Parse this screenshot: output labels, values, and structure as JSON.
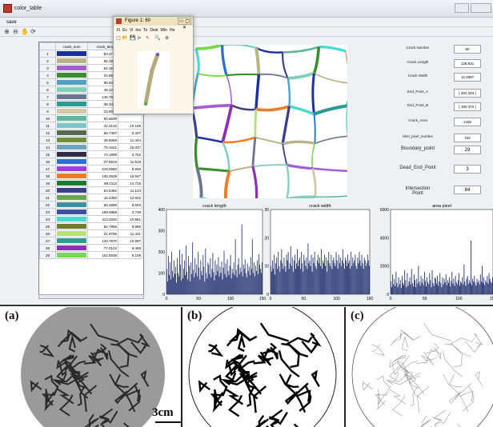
{
  "window": {
    "title": "color_table"
  },
  "menu": {
    "save": "save"
  },
  "toolbar": {
    "icons": [
      "zoom-in-icon",
      "zoom-out-icon",
      "pan-icon",
      "rotate-icon"
    ]
  },
  "table": {
    "headers": [
      "crack_num",
      "crack_length",
      "c"
    ],
    "rows": [
      {
        "n": "1",
        "color": "#1c2fa0",
        "len": "83.4767",
        "ext": ""
      },
      {
        "n": "2",
        "color": "#b9b487",
        "len": "56.1838",
        "ext": ""
      },
      {
        "n": "3",
        "color": "#a25ed3",
        "len": "62.1599",
        "ext": ""
      },
      {
        "n": "4",
        "color": "#3b8e2e",
        "len": "24.8640",
        "ext": ""
      },
      {
        "n": "5",
        "color": "#4fa3c9",
        "len": "85.8467",
        "ext": ""
      },
      {
        "n": "6",
        "color": "#7dd0ba",
        "len": "48.1274",
        "ext": ""
      },
      {
        "n": "7",
        "color": "#6a7590",
        "len": "145.7676",
        "ext": ""
      },
      {
        "n": "8",
        "color": "#2a9a92",
        "len": "38.3482",
        "ext": ""
      },
      {
        "n": "9",
        "color": "#d2c8a6",
        "len": "23.6056",
        "ext": ""
      },
      {
        "n": "10",
        "color": "#5eb79c",
        "len": "84.6639",
        "ext": ""
      },
      {
        "n": "11",
        "color": "#7ec8cc",
        "len": "42.2132",
        "ext": "10.169"
      },
      {
        "n": "12",
        "color": "#4f6c4e",
        "len": "66.7487",
        "ext": "5.427"
      },
      {
        "n": "13",
        "color": "#6f8f3a",
        "len": "28.6569",
        "ext": "11.444"
      },
      {
        "n": "14",
        "color": "#6da6c1",
        "len": "75.1641",
        "ext": "15.037"
      },
      {
        "n": "15",
        "color": "#2d2a4a",
        "len": "74.1899",
        "ext": "3.752"
      },
      {
        "n": "16",
        "color": "#2e6fd6",
        "len": "27.5919",
        "ext": "11.619"
      },
      {
        "n": "17",
        "color": "#a23bd9",
        "len": "219.0680",
        "ext": "8.948"
      },
      {
        "n": "18",
        "color": "#f27b21",
        "len": "135.3528",
        "ext": "16.547"
      },
      {
        "n": "19",
        "color": "#1f7a37",
        "len": "88.0113",
        "ext": "14.718"
      },
      {
        "n": "20",
        "color": "#3a3f8c",
        "len": "54.6482",
        "ext": "11.124"
      },
      {
        "n": "21",
        "color": "#6ba64f",
        "len": "15.4350",
        "ext": "12.602"
      },
      {
        "n": "22",
        "color": "#3d8fa5",
        "len": "66.2696",
        "ext": "8.603"
      },
      {
        "n": "23",
        "color": "#3b4fa3",
        "len": "199.0868",
        "ext": "3.748"
      },
      {
        "n": "24",
        "color": "#48d9d2",
        "len": "113.3320",
        "ext": "10.961"
      },
      {
        "n": "25",
        "color": "#6f7c2f",
        "len": "82.7965",
        "ext": "8.898"
      },
      {
        "n": "26",
        "color": "#b6e07a",
        "len": "21.9796",
        "ext": "11.441"
      },
      {
        "n": "27",
        "color": "#2f9a8e",
        "len": "140.7670",
        "ext": "10.597"
      },
      {
        "n": "28",
        "color": "#8f2fb8",
        "len": "77.0122",
        "ext": "8.459"
      },
      {
        "n": "29",
        "color": "#7ad94a",
        "len": "102.5538",
        "ext": "9.109"
      }
    ]
  },
  "figure": {
    "title": "Figure 1: 60",
    "menu": [
      "Fi",
      "Ec",
      "Vi",
      "Ins",
      "To",
      "Desl",
      "Win",
      "He"
    ],
    "tools": "▢📂💾⊳ ↖ 🔍 ⊕"
  },
  "properties": [
    {
      "label": "Crack Number",
      "value": "60",
      "big": false
    },
    {
      "label": "Crack Length",
      "value": "128.831",
      "big": false
    },
    {
      "label": "Crack Width",
      "value": "12.2887",
      "big": false
    },
    {
      "label": "End_Point_A",
      "value": "[ 281  334 ]",
      "big": false
    },
    {
      "label": "End_Point_B",
      "value": "[ 190  370 ]",
      "big": false
    },
    {
      "label": "Crack_Area",
      "value": "1436",
      "big": false
    },
    {
      "label": "Skel_pixel_number",
      "value": "102",
      "big": false
    },
    {
      "label": "Boundary_point",
      "value": "29",
      "big": true
    },
    {
      "label": "Dead_End_Point",
      "value": "3",
      "big": true
    },
    {
      "label": "Intersection\nPoint",
      "value": "84",
      "big": true
    }
  ],
  "chart_data": [
    {
      "type": "bar",
      "title": "crack length",
      "xlim": [
        0,
        150
      ],
      "ylim": [
        0,
        400
      ],
      "xticks": [
        "0",
        "50",
        "100",
        "150"
      ],
      "yticks": [
        "0",
        "100",
        "200",
        "300",
        "400"
      ],
      "color": "#1a2a6c",
      "values": [
        120,
        60,
        180,
        90,
        150,
        70,
        200,
        110,
        80,
        160,
        95,
        130,
        55,
        170,
        100,
        85,
        210,
        140,
        65,
        190,
        75,
        120,
        160,
        90,
        230,
        105,
        70,
        180,
        135,
        60,
        150,
        95,
        245,
        115,
        80,
        170,
        100,
        140,
        85,
        200,
        125,
        70,
        160,
        110,
        90,
        185,
        130,
        60,
        215,
        100,
        75,
        150,
        140,
        95,
        170,
        80,
        120,
        195,
        105,
        65,
        160,
        90,
        140,
        110,
        175,
        85,
        130,
        100,
        155,
        70,
        125,
        205,
        95,
        145,
        80,
        165,
        110,
        90,
        135,
        185,
        75,
        120,
        100,
        150,
        90,
        260,
        115,
        80,
        140,
        170,
        95,
        125,
        105,
        330,
        85,
        140,
        120,
        165,
        100,
        80,
        145,
        110,
        130,
        90,
        175,
        120,
        260,
        100,
        150,
        85,
        135,
        110,
        160,
        95,
        190,
        140,
        120,
        100,
        150
      ]
    },
    {
      "type": "bar",
      "title": "crack width",
      "xlim": [
        0,
        150
      ],
      "ylim": [
        0,
        30
      ],
      "xticks": [
        "0",
        "50",
        "100",
        "150"
      ],
      "yticks": [
        "0",
        "10",
        "20",
        "30"
      ],
      "color": "#1a2a6c",
      "values": [
        10,
        8,
        12,
        9,
        14,
        7,
        11,
        13,
        9,
        15,
        10,
        8,
        12,
        16,
        11,
        9,
        13,
        10,
        8,
        14,
        12,
        15,
        9,
        11,
        17,
        10,
        13,
        8,
        12,
        14,
        9,
        11,
        16,
        10,
        12,
        13,
        9,
        15,
        11,
        8,
        14,
        12,
        10,
        13,
        9,
        18,
        11,
        12,
        10,
        14,
        8,
        13,
        11,
        15,
        10,
        9,
        12,
        14,
        11,
        13,
        10,
        16,
        9,
        12,
        11,
        14,
        10,
        13,
        8,
        12,
        15,
        11,
        10,
        14,
        9,
        12,
        13,
        11,
        10,
        15,
        12,
        9,
        14,
        11,
        13,
        10,
        12,
        16,
        11,
        9,
        13,
        12,
        10,
        14,
        11,
        12,
        9,
        15,
        10,
        13,
        11,
        12,
        14,
        10,
        9,
        13,
        11,
        15,
        12,
        10,
        14,
        11,
        9,
        13,
        12,
        10,
        11,
        14,
        12,
        10
      ]
    },
    {
      "type": "bar",
      "title": "area pixel",
      "xlim": [
        0,
        150
      ],
      "ylim": [
        0,
        6000
      ],
      "xticks": [
        "0",
        "50",
        "100",
        "150"
      ],
      "yticks": [
        "0",
        "2000",
        "4000",
        "6000"
      ],
      "color": "#1a2a6c",
      "values": [
        900,
        500,
        1400,
        700,
        1100,
        600,
        1600,
        800,
        500,
        1200,
        700,
        1000,
        450,
        1300,
        800,
        650,
        1700,
        1000,
        500,
        1500,
        600,
        900,
        1200,
        700,
        1800,
        800,
        550,
        1400,
        1000,
        500,
        1100,
        750,
        2000,
        900,
        600,
        1300,
        800,
        1100,
        650,
        1600,
        950,
        550,
        1200,
        850,
        700,
        1500,
        1000,
        500,
        1700,
        800,
        600,
        1200,
        1100,
        750,
        1300,
        600,
        900,
        1500,
        800,
        500,
        1200,
        700,
        1100,
        850,
        1400,
        650,
        1000,
        800,
        1200,
        550,
        950,
        1600,
        750,
        1100,
        600,
        1300,
        850,
        700,
        1000,
        1500,
        600,
        900,
        800,
        1200,
        700,
        2100,
        900,
        600,
        1100,
        1300,
        750,
        1000,
        800,
        3800,
        650,
        1100,
        900,
        1300,
        800,
        600,
        1100,
        850,
        1000,
        700,
        1400,
        900,
        2000,
        800,
        1200,
        650,
        1000,
        850,
        1300,
        750,
        1500,
        1100,
        900,
        800,
        1200
      ]
    }
  ],
  "bottom": {
    "labels": [
      "(a)",
      "(b)",
      "(c)"
    ],
    "scale": "3cm"
  }
}
